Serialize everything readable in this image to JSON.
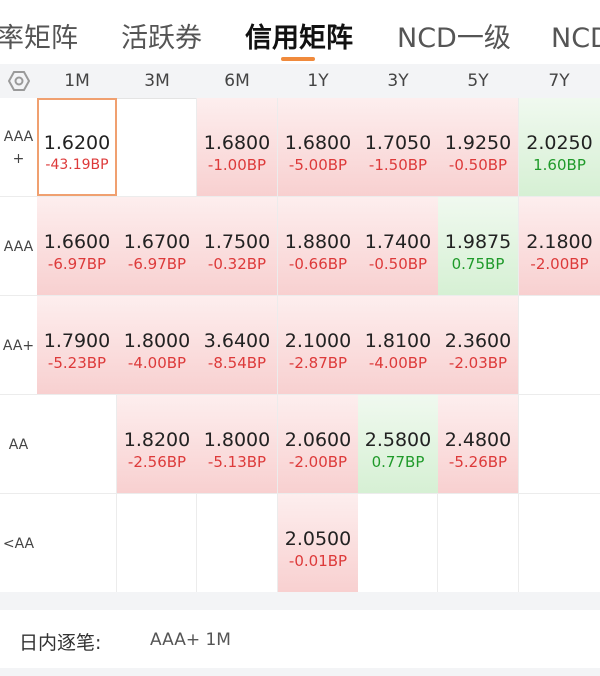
{
  "tabs": [
    {
      "label": "率矩阵",
      "active": false
    },
    {
      "label": "活跃券",
      "active": false
    },
    {
      "label": "信用矩阵",
      "active": true
    },
    {
      "label": "NCD一级",
      "active": false
    },
    {
      "label": "NCD",
      "active": false
    }
  ],
  "accent_color": "#f08a3c",
  "grid": {
    "settings_icon": "gear-icon",
    "columns": [
      "1M",
      "3M",
      "6M",
      "1Y",
      "3Y",
      "5Y",
      "7Y"
    ],
    "rows": [
      {
        "label": "AAA\n+",
        "cells": [
          {
            "price": "1.6200",
            "change": "-43.19BP",
            "tone": "neg",
            "selected": true
          },
          null,
          {
            "price": "1.6800",
            "change": "-1.00BP",
            "tone": "neg"
          },
          {
            "price": "1.6800",
            "change": "-5.00BP",
            "tone": "neg"
          },
          {
            "price": "1.7050",
            "change": "-1.50BP",
            "tone": "neg"
          },
          {
            "price": "1.9250",
            "change": "-0.50BP",
            "tone": "neg"
          },
          {
            "price": "2.0250",
            "change": "1.60BP",
            "tone": "pos"
          }
        ]
      },
      {
        "label": "AAA",
        "cells": [
          {
            "price": "1.6600",
            "change": "-6.97BP",
            "tone": "neg"
          },
          {
            "price": "1.6700",
            "change": "-6.97BP",
            "tone": "neg"
          },
          {
            "price": "1.7500",
            "change": "-0.32BP",
            "tone": "neg"
          },
          {
            "price": "1.8800",
            "change": "-0.66BP",
            "tone": "neg"
          },
          {
            "price": "1.7400",
            "change": "-0.50BP",
            "tone": "neg"
          },
          {
            "price": "1.9875",
            "change": "0.75BP",
            "tone": "pos"
          },
          {
            "price": "2.1800",
            "change": "-2.00BP",
            "tone": "neg"
          }
        ]
      },
      {
        "label": "AA+",
        "cells": [
          {
            "price": "1.7900",
            "change": "-5.23BP",
            "tone": "neg"
          },
          {
            "price": "1.8000",
            "change": "-4.00BP",
            "tone": "neg"
          },
          {
            "price": "3.6400",
            "change": "-8.54BP",
            "tone": "neg"
          },
          {
            "price": "2.1000",
            "change": "-2.87BP",
            "tone": "neg"
          },
          {
            "price": "1.8100",
            "change": "-4.00BP",
            "tone": "neg"
          },
          {
            "price": "2.3600",
            "change": "-2.03BP",
            "tone": "neg"
          },
          null
        ]
      },
      {
        "label": "AA",
        "cells": [
          null,
          {
            "price": "1.8200",
            "change": "-2.56BP",
            "tone": "neg"
          },
          {
            "price": "1.8000",
            "change": "-5.13BP",
            "tone": "neg"
          },
          {
            "price": "2.0600",
            "change": "-2.00BP",
            "tone": "neg"
          },
          {
            "price": "2.5800",
            "change": "0.77BP",
            "tone": "pos"
          },
          {
            "price": "2.4800",
            "change": "-5.26BP",
            "tone": "neg"
          },
          null
        ]
      },
      {
        "label": "<AA",
        "cells": [
          null,
          null,
          null,
          {
            "price": "2.0500",
            "change": "-0.01BP",
            "tone": "neg"
          },
          null,
          null,
          null
        ]
      }
    ]
  },
  "footer": {
    "label": "日内逐笔:",
    "value": "AAA+ 1M"
  }
}
